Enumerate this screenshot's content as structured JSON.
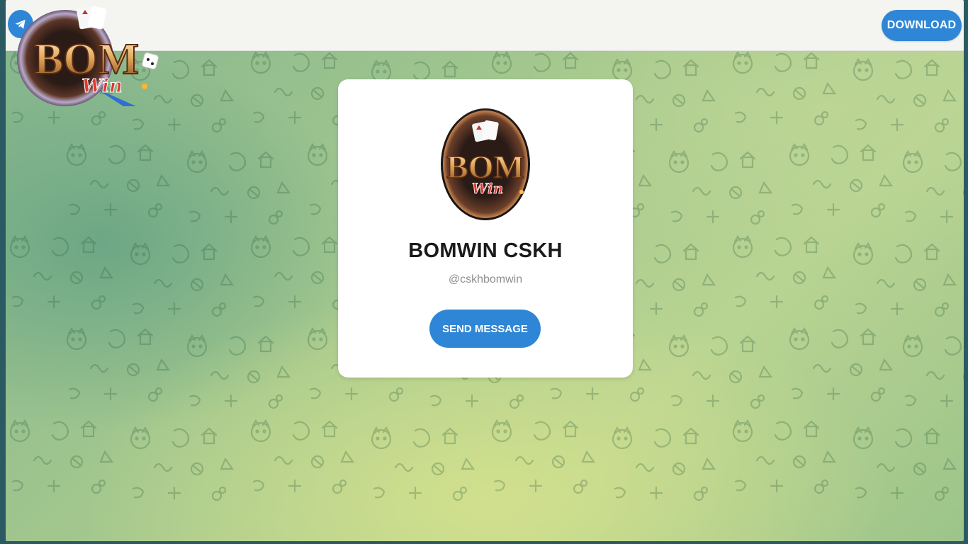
{
  "header": {
    "download_label": "DOWNLOAD",
    "telegram_icon": "telegram-plane-icon"
  },
  "profile": {
    "name": "BOMWIN CSKH",
    "username": "@cskhbomwin",
    "avatar_logo_text": "BOM",
    "avatar_logo_script": "Win",
    "send_label": "SEND MESSAGE"
  },
  "site_logo": {
    "logo_text": "BOM",
    "logo_script": "Win"
  },
  "colors": {
    "accent": "#2f86d6",
    "card": "#ffffff",
    "background_green": "#9cc48a"
  }
}
